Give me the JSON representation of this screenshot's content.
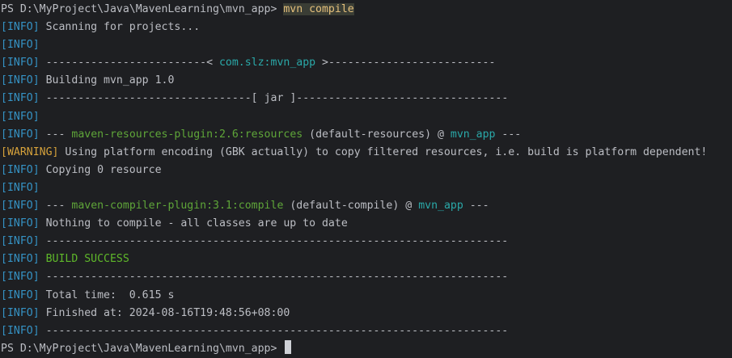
{
  "terminal": {
    "prompt": "PS D:\\MyProject\\Java\\MavenLearning\\mvn_app>",
    "command": "mvn compile",
    "info_tag": "[INFO]",
    "warning_tag": "[WARNING]",
    "scanning": "Scanning for projects...",
    "sep_left_artifact": "-------------------------<",
    "artifact_id": "com.slz:mvn_app",
    "sep_right_artifact": ">--------------------------",
    "building": "Building mvn_app 1.0",
    "sep_left_jar": "--------------------------------[",
    "packaging": "jar",
    "sep_right_jar": "]---------------------------------",
    "dashes3": "---",
    "resources_plugin": "maven-resources-plugin:2.6:resources",
    "resources_exec": "(default-resources)",
    "at_sign": "@",
    "project": "mvn_app",
    "warning_msg": "Using platform encoding (GBK actually) to copy filtered resources, i.e. build is platform dependent!",
    "copying": "Copying 0 resource",
    "compiler_plugin": "maven-compiler-plugin:3.1:compile",
    "compile_exec": "(default-compile)",
    "nothing": "Nothing to compile - all classes are up to date",
    "long_sep": "------------------------------------------------------------------------",
    "build_success": "BUILD SUCCESS",
    "total_time": "Total time:  0.615 s",
    "finished_at": "Finished at: 2024-08-16T19:48:56+08:00"
  },
  "colors": {
    "background": "#1e1f22",
    "text": "#bcbec4",
    "info": "#3592c4",
    "warning": "#d5a13b",
    "teal": "#2aa9a9",
    "plugin_green": "#5fa639",
    "success_green": "#5fb82a",
    "command_yellow": "#e5c07b"
  }
}
